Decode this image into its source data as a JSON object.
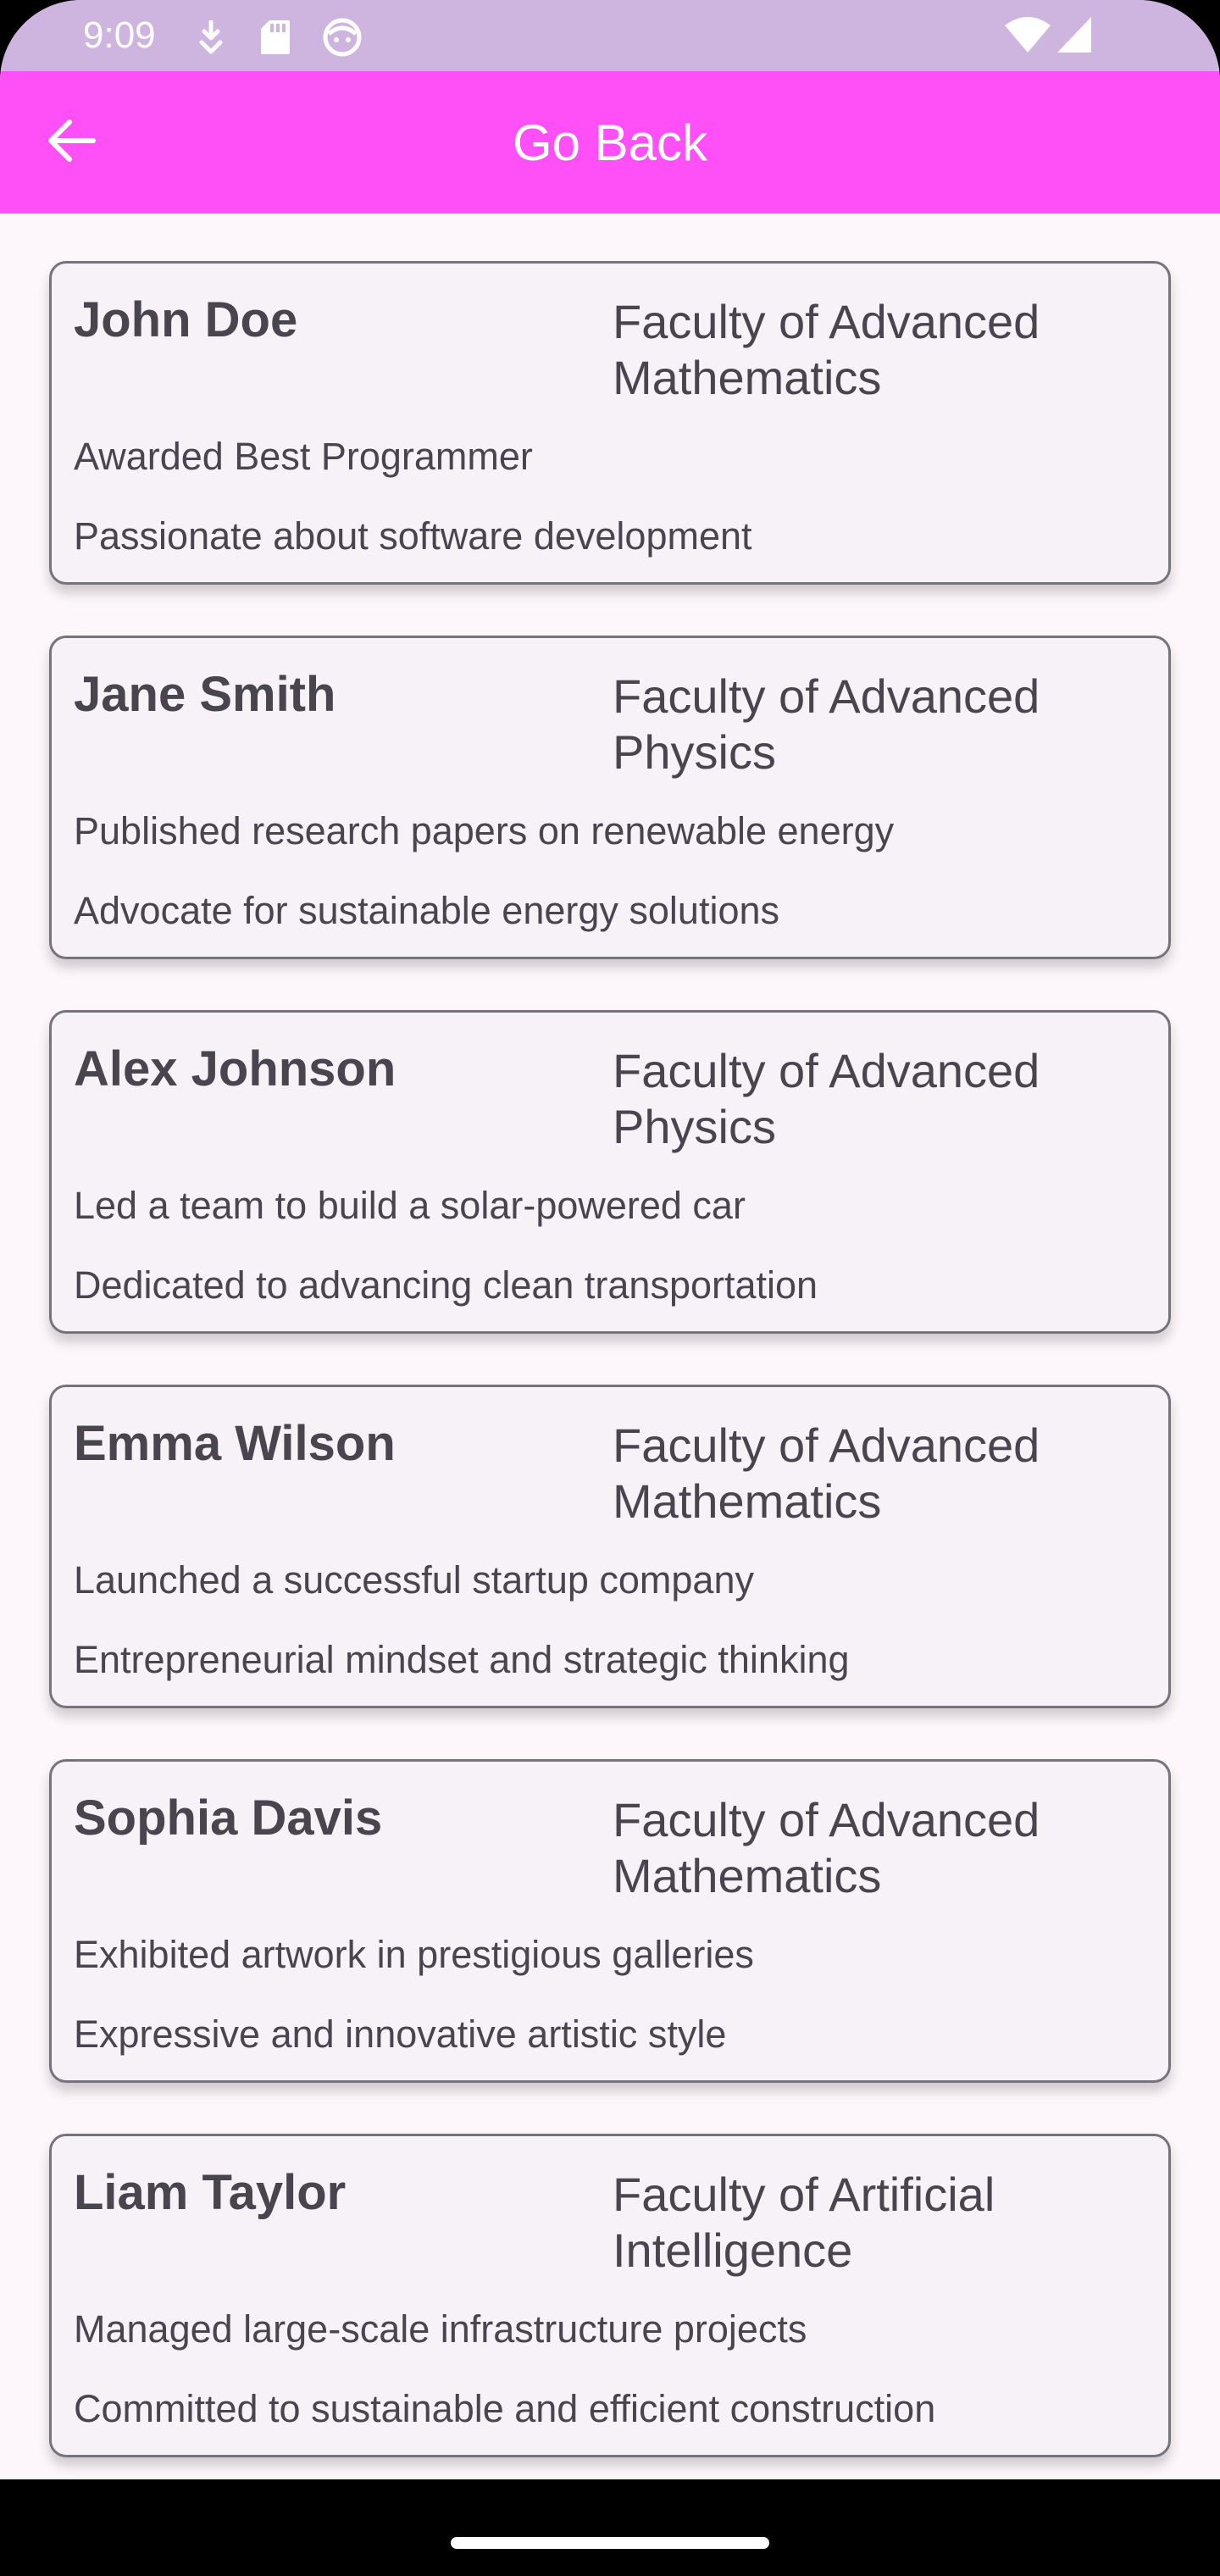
{
  "status_bar": {
    "time": "9:09",
    "icons_left": [
      "download-icon",
      "sd-card-icon",
      "face-icon"
    ],
    "icons_right": [
      "wifi-icon",
      "cellular-signal-icon"
    ]
  },
  "app_bar": {
    "title": "Go Back",
    "back_icon": "arrow-back-icon",
    "color": "#ff4ff6"
  },
  "students": [
    {
      "name": "John Doe",
      "faculty": "Faculty of Advanced Mathematics",
      "achievement": "Awarded Best Programmer",
      "description": "Passionate about software development"
    },
    {
      "name": "Jane Smith",
      "faculty": "Faculty of Advanced Physics",
      "achievement": "Published research papers on renewable energy",
      "description": "Advocate for sustainable energy solutions"
    },
    {
      "name": "Alex Johnson",
      "faculty": "Faculty of Advanced Physics",
      "achievement": "Led a team to build a solar-powered car",
      "description": "Dedicated to advancing clean transportation"
    },
    {
      "name": "Emma Wilson",
      "faculty": "Faculty of Advanced Mathematics",
      "achievement": "Launched a successful startup company",
      "description": "Entrepreneurial mindset and strategic thinking"
    },
    {
      "name": "Sophia Davis",
      "faculty": "Faculty of Advanced Mathematics",
      "achievement": "Exhibited artwork in prestigious galleries",
      "description": "Expressive and innovative artistic style"
    },
    {
      "name": "Liam Taylor",
      "faculty": "Faculty of Artificial Intelligence",
      "achievement": "Managed large-scale infrastructure projects",
      "description": "Committed to sustainable and efficient construction"
    }
  ]
}
